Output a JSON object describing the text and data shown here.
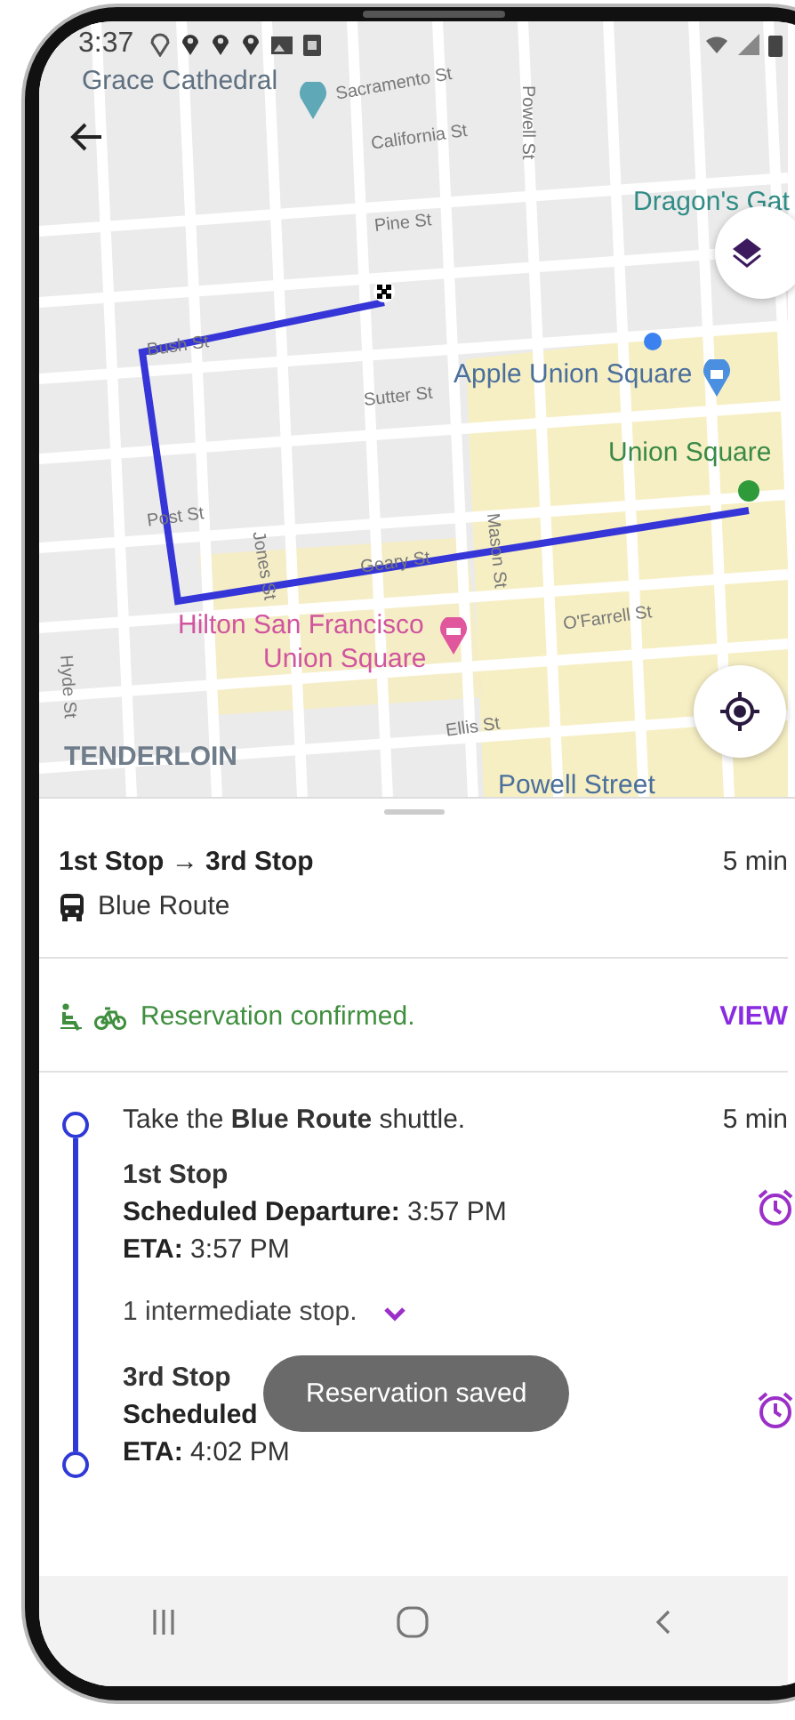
{
  "status_bar": {
    "time": "3:37"
  },
  "map": {
    "labels": [
      {
        "text": "Grace Cathedral",
        "kind": "poi",
        "color": "#5f7080"
      },
      {
        "text": "Sacramento St",
        "kind": "street"
      },
      {
        "text": "California St",
        "kind": "street"
      },
      {
        "text": "Powell St",
        "kind": "street"
      },
      {
        "text": "Pine St",
        "kind": "street"
      },
      {
        "text": "Dragon's Gat",
        "kind": "poi",
        "color": "#2f8c86"
      },
      {
        "text": "Bush St",
        "kind": "street"
      },
      {
        "text": "Sutter St",
        "kind": "street"
      },
      {
        "text": "Apple Union Square",
        "kind": "poi",
        "color": "#4a6f9c"
      },
      {
        "text": "Union Square",
        "kind": "poi",
        "color": "#3a8a47"
      },
      {
        "text": "Post St",
        "kind": "street"
      },
      {
        "text": "Jones St",
        "kind": "street"
      },
      {
        "text": "Mason St",
        "kind": "street"
      },
      {
        "text": "Geary St",
        "kind": "street"
      },
      {
        "text": "Hilton San Francisco",
        "kind": "poi",
        "color": "#d0559e"
      },
      {
        "text": "Union Square",
        "kind": "poi",
        "color": "#d0559e"
      },
      {
        "text": "O'Farrell St",
        "kind": "street"
      },
      {
        "text": "Ellis St",
        "kind": "street"
      },
      {
        "text": "Hyde St",
        "kind": "street"
      },
      {
        "text": "TENDERLOIN",
        "kind": "district"
      },
      {
        "text": "Powell Street",
        "kind": "poi",
        "color": "#4a6f9c"
      }
    ]
  },
  "trip": {
    "title": "1st Stop → 3rd Stop",
    "duration": "5 min",
    "route": "Blue Route"
  },
  "reservation": {
    "message": "Reservation confirmed.",
    "action": "VIEW"
  },
  "itinerary": {
    "instruction": "Take the **Blue Route** shuttle.",
    "duration": "5 min",
    "stops": [
      {
        "name": "1st Stop",
        "lines": [
          {
            "label": "Scheduled Departure:",
            "value": "3:57 PM"
          },
          {
            "label": "ETA:",
            "value": "3:57 PM"
          }
        ]
      },
      {
        "name": "3rd Stop",
        "lines": [
          {
            "label": "Scheduled"
          },
          {
            "label": "ETA:",
            "value": "4:02 PM"
          }
        ]
      }
    ],
    "intermediate": {
      "text": "1 intermediate stop.",
      "expanded": false
    }
  },
  "toast": "Reservation saved"
}
